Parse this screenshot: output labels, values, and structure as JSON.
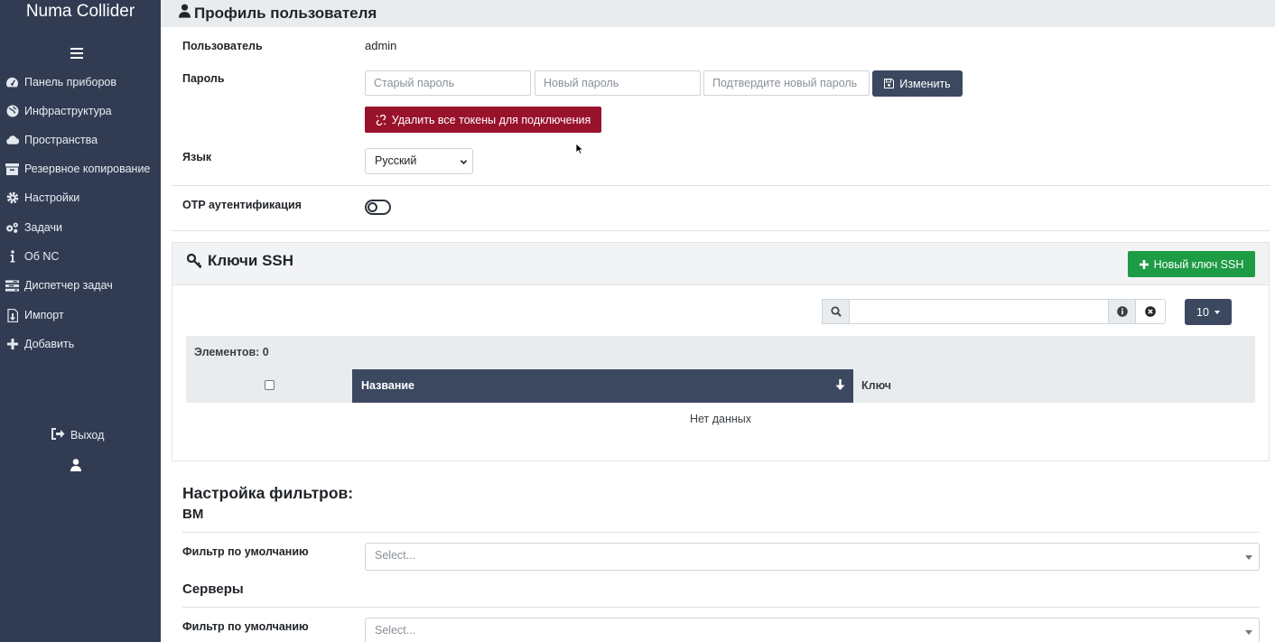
{
  "app": {
    "title": "Numa Collider"
  },
  "sidebar": {
    "items": [
      {
        "label": "Панель приборов",
        "icon": "dashboard-icon"
      },
      {
        "label": "Инфраструктура",
        "icon": "globe-icon"
      },
      {
        "label": "Пространства",
        "icon": "cloud-icon"
      },
      {
        "label": "Резервное копирование",
        "icon": "archive-icon"
      },
      {
        "label": "Настройки",
        "icon": "gear-icon"
      },
      {
        "label": "Задачи",
        "icon": "gears-icon"
      },
      {
        "label": "Об NC",
        "icon": "info-icon"
      },
      {
        "label": "Диспетчер задач",
        "icon": "tasks-icon"
      },
      {
        "label": "Импорт",
        "icon": "import-icon"
      },
      {
        "label": "Добавить",
        "icon": "plus-icon"
      }
    ],
    "logout_label": "Выход"
  },
  "header": {
    "title": "Профиль пользователя"
  },
  "profile": {
    "user_label": "Пользователь",
    "user_value": "admin",
    "password_label": "Пароль",
    "old_password_placeholder": "Старый пароль",
    "new_password_placeholder": "Новый пароль",
    "confirm_password_placeholder": "Подтвердите новый пароль",
    "change_button": "Изменить",
    "delete_tokens_button": "Удалить все токены для подключения",
    "language_label": "Язык",
    "language_value": "Русский",
    "otp_label": "OTP аутентификация",
    "otp_enabled": false
  },
  "ssh": {
    "title": "Ключи SSH",
    "new_key_button": "Новый ключ SSH",
    "page_size": "10",
    "count_text": "Элементов: 0",
    "columns": [
      "Название",
      "Ключ"
    ],
    "no_data": "Нет данных"
  },
  "filters": {
    "title": "Настройка фильтров:",
    "vm_section": "ВМ",
    "servers_section": "Серверы",
    "default_filter_label": "Фильтр по умолчанию",
    "select_placeholder": "Select..."
  },
  "colors": {
    "sidebar": "#313c53",
    "primary_dark": "#3c4860",
    "danger": "#99122b",
    "success": "#1d9b45"
  }
}
